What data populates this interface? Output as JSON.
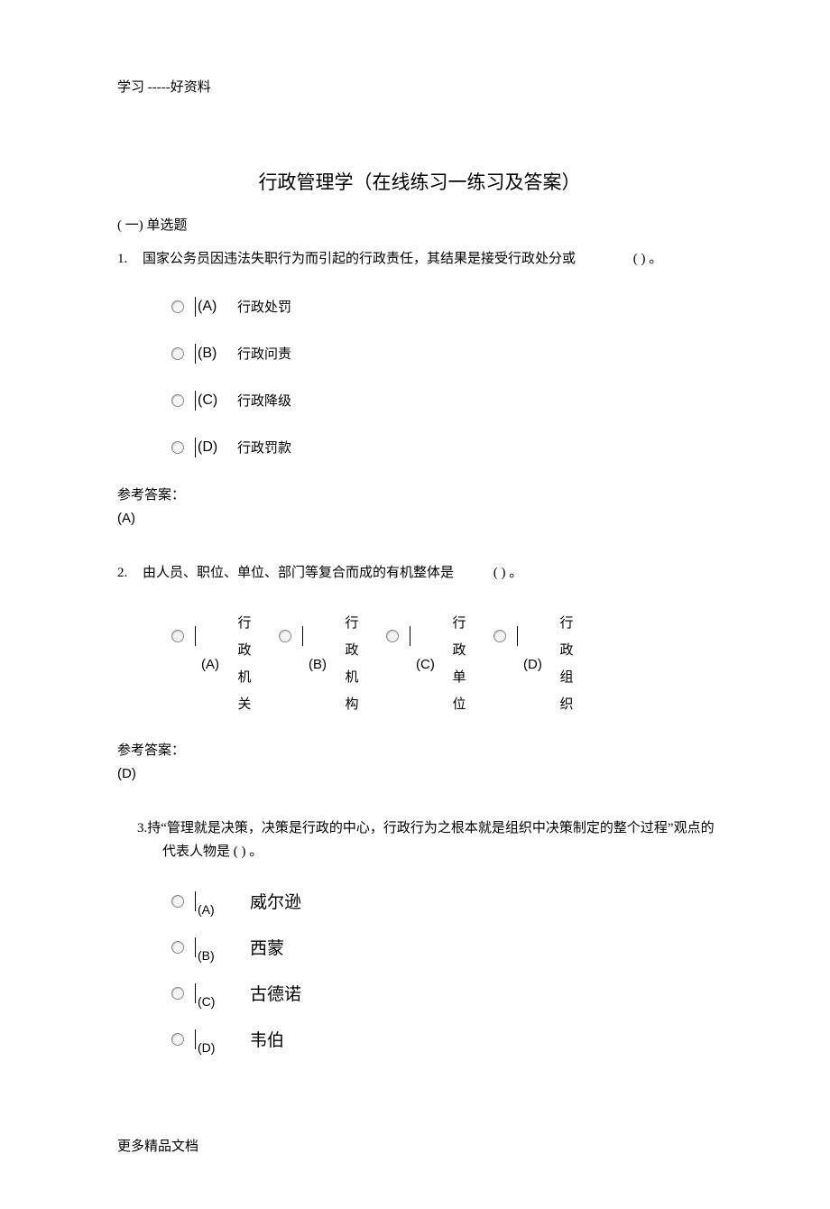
{
  "header": "学习 -----好资料",
  "title": "行政管理学（在线练习一练习及答案）",
  "section_label": "( 一)   单选题",
  "q1": {
    "num": "1.",
    "text_before": "国家公务员因违法失职行为而引起的行政责任，其结果是接受行政处分或",
    "blank": "(  )  。",
    "opts": {
      "a": {
        "letter": "(A)",
        "text": "行政处罚"
      },
      "b": {
        "letter": "(B)",
        "text": "行政问责"
      },
      "c": {
        "letter": "(C)",
        "text": "行政降级"
      },
      "d": {
        "letter": "(D)",
        "text": "行政罚款"
      }
    },
    "ans_label": "参考答案：",
    "ans": "(A)"
  },
  "q2": {
    "num": "2.",
    "text_before": "由人员、职位、单位、部门等复合而成的有机整体是",
    "blank": "(  )  。",
    "opts": {
      "a": {
        "letter": "(A)",
        "c1": "行",
        "c2": "政",
        "c3": "机",
        "c4": "关"
      },
      "b": {
        "letter": "(B)",
        "c1": "行",
        "c2": "政",
        "c3": "机",
        "c4": "构"
      },
      "c": {
        "letter": "(C)",
        "c1": "行",
        "c2": "政",
        "c3": "单",
        "c4": "位"
      },
      "d": {
        "letter": "(D)",
        "c1": "行",
        "c2": "政",
        "c3": "组",
        "c4": "织"
      }
    },
    "ans_label": "参考答案：",
    "ans": "(D)"
  },
  "q3": {
    "num": "3.",
    "text": "持“管理就是决策，决策是行政的中心，行政行为之根本就是组织中决策制定的整个过程”观点的代表人物是 ( ) 。",
    "opts": {
      "a": {
        "letter": "(A)",
        "text": "威尔逊"
      },
      "b": {
        "letter": "(B)",
        "text": "西蒙"
      },
      "c": {
        "letter": "(C)",
        "text": "古德诺"
      },
      "d": {
        "letter": "(D)",
        "text": "韦伯"
      }
    }
  },
  "footer": "更多精品文档"
}
